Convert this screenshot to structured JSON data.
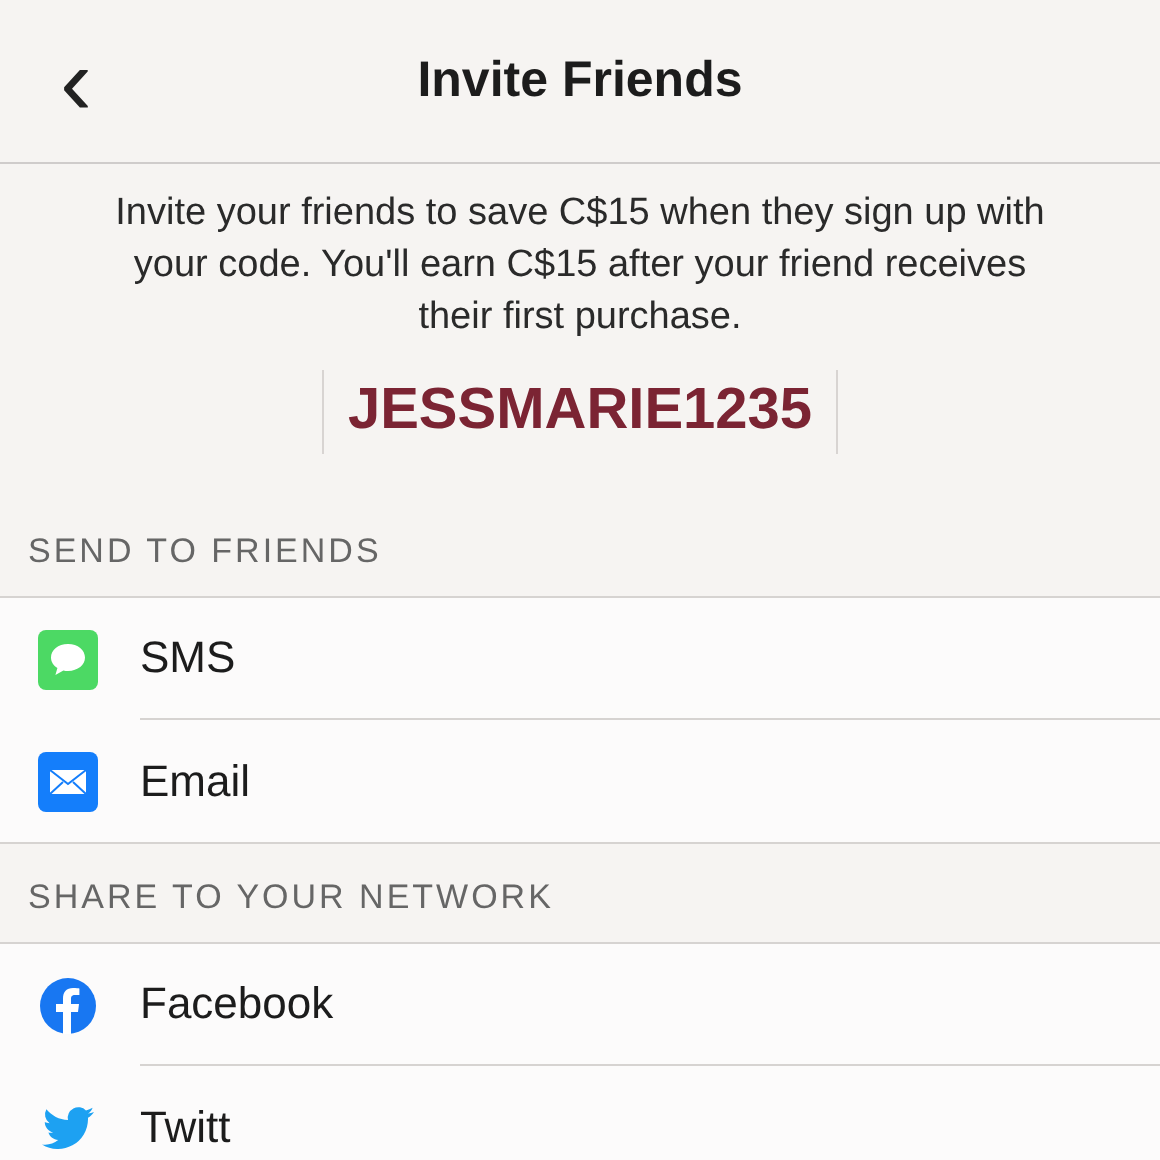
{
  "header": {
    "back": "‹",
    "title": "Invite Friends"
  },
  "description": "Invite your friends to save C$15 when they sign up with your code. You'll earn C$15 after your friend receives their first purchase.",
  "code": "JESSMARIE1235",
  "sections": [
    {
      "title": "SEND TO FRIENDS",
      "items": [
        {
          "label": "SMS",
          "kind": "sms"
        },
        {
          "label": "Email",
          "kind": "email"
        }
      ]
    },
    {
      "title": "SHARE TO YOUR NETWORK",
      "items": [
        {
          "label": "Facebook",
          "kind": "facebook"
        },
        {
          "label": "Twitt",
          "kind": "twitter"
        }
      ]
    }
  ]
}
